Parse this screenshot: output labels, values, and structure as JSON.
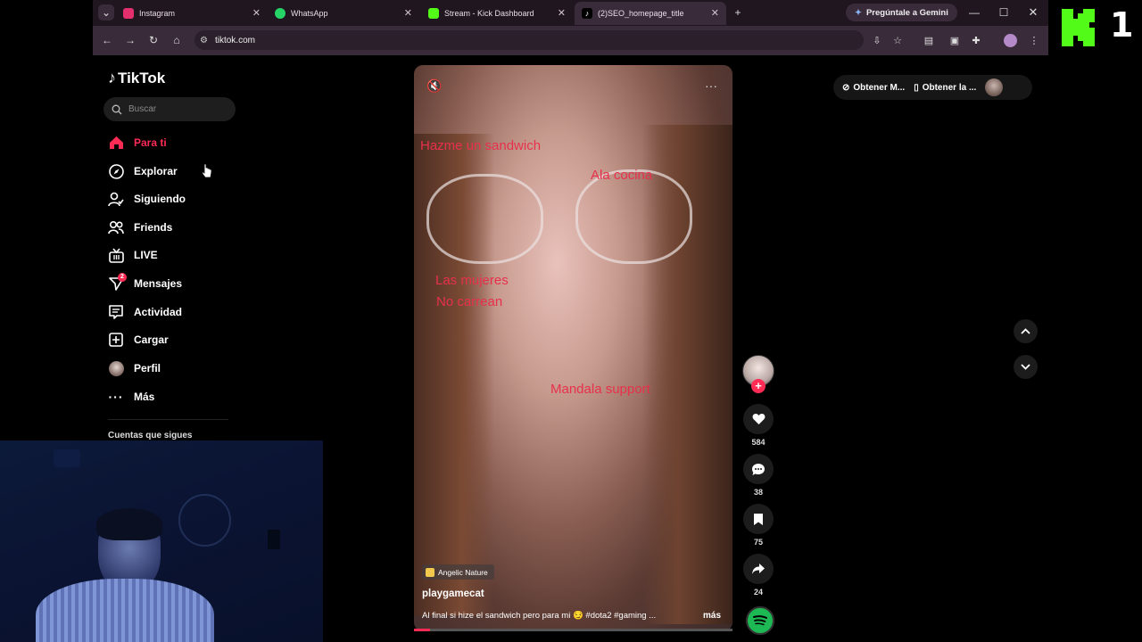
{
  "browser": {
    "tabs": [
      {
        "label": "Instagram",
        "icon": "instagram-icon",
        "color": "#e1306c"
      },
      {
        "label": "WhatsApp",
        "icon": "whatsapp-icon",
        "color": "#25d366"
      },
      {
        "label": "Stream - Kick Dashboard",
        "icon": "kick-icon",
        "color": "#53fc18"
      },
      {
        "label": "(2)SEO_homepage_title",
        "icon": "tiktok-icon",
        "color": "#ffffff"
      }
    ],
    "url": "tiktok.com",
    "gemini_label": "Pregúntale a Gemini"
  },
  "overlay": {
    "kick_number": "1"
  },
  "tiktok": {
    "logo": "TikTok",
    "search_placeholder": "Buscar",
    "nav": [
      {
        "label": "Para ti",
        "icon": "home-icon",
        "active": true
      },
      {
        "label": "Explorar",
        "icon": "compass-icon"
      },
      {
        "label": "Siguiendo",
        "icon": "following-icon"
      },
      {
        "label": "Friends",
        "icon": "friends-icon"
      },
      {
        "label": "LIVE",
        "icon": "live-icon"
      },
      {
        "label": "Mensajes",
        "icon": "messages-icon",
        "badge": "2"
      },
      {
        "label": "Actividad",
        "icon": "activity-icon"
      },
      {
        "label": "Cargar",
        "icon": "upload-icon"
      },
      {
        "label": "Perfil",
        "icon": "profile-avatar"
      },
      {
        "label": "Más",
        "icon": "more-icon"
      }
    ],
    "following_header": "Cuentas que sigues",
    "top_right": {
      "pill1": "Obtener M...",
      "pill2": "Obtener la ..."
    },
    "video": {
      "overlay_texts": [
        "Hazme un sandwich",
        "Ala cocina",
        "Las mujeres",
        "No carrean",
        "Mandala support"
      ],
      "effect": "Angelic Nature",
      "author": "playgamecat",
      "caption": "Al final si hize el sandwich pero para mi 😏 #dota2 #gaming ...",
      "more": "más"
    },
    "actions": {
      "likes": "584",
      "comments": "38",
      "saves": "75",
      "shares": "24"
    }
  }
}
